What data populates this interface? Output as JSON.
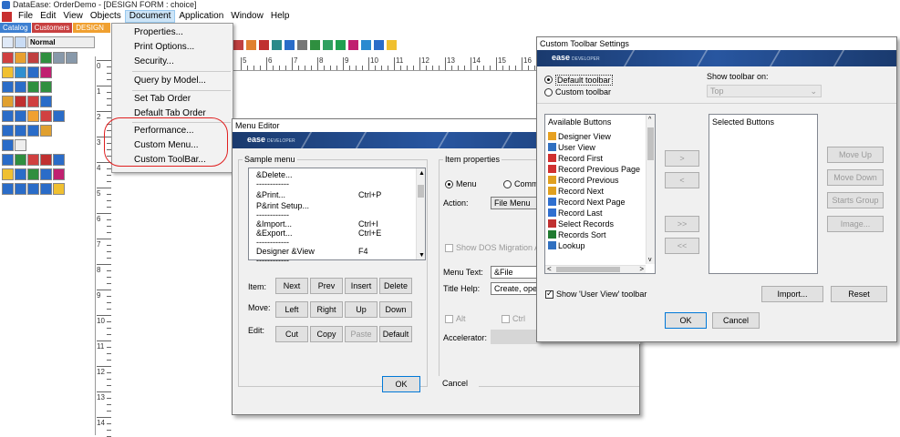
{
  "window": {
    "title": "DataEase: OrderDemo - [DESIGN FORM : choice]"
  },
  "menubar": {
    "items": [
      "File",
      "Edit",
      "View",
      "Objects",
      "Document",
      "Application",
      "Window",
      "Help"
    ],
    "active": "Document"
  },
  "tabstrip": {
    "tabs": [
      "Catalog",
      "Customers",
      "DESIGN FOR"
    ]
  },
  "toolbar": {
    "field_style": "Normal"
  },
  "vruler": {
    "labels": [
      "0",
      "1",
      "2",
      "3",
      "4",
      "5",
      "6",
      "7",
      "8",
      "9",
      "10",
      "11",
      "12",
      "13",
      "14"
    ]
  },
  "hruler": {
    "labels": [
      "5",
      "6",
      "7",
      "8",
      "9",
      "10",
      "11",
      "12",
      "13",
      "14",
      "15",
      "16"
    ]
  },
  "document_menu": {
    "items": [
      {
        "label": "Properties..."
      },
      {
        "label": "Print Options..."
      },
      {
        "label": "Security..."
      },
      {
        "label": "Query by Model..."
      },
      {
        "label": "Set Tab Order"
      },
      {
        "label": "Default Tab Order"
      },
      {
        "label": "Performance..."
      },
      {
        "label": "Custom Menu..."
      },
      {
        "label": "Custom ToolBar..."
      }
    ]
  },
  "menu_editor": {
    "title": "Menu Editor",
    "banner_logo": "ease",
    "banner_sub": "DEVELOPER",
    "sample_menu_label": "Sample menu",
    "sample_rows": [
      {
        "name": "&Delete...",
        "key": ""
      },
      {
        "name": "------------",
        "key": ""
      },
      {
        "name": "&Print...",
        "key": "Ctrl+P"
      },
      {
        "name": "P&rint Setup...",
        "key": ""
      },
      {
        "name": "------------",
        "key": ""
      },
      {
        "name": "&Import...",
        "key": "Ctrl+I"
      },
      {
        "name": "&Export...",
        "key": "Ctrl+E"
      },
      {
        "name": "------------",
        "key": ""
      },
      {
        "name": "Designer &View",
        "key": "F4"
      },
      {
        "name": "------------",
        "key": ""
      }
    ],
    "item_label": "Item:",
    "move_label": "Move:",
    "edit_label": "Edit:",
    "item_buttons": [
      "Next",
      "Prev",
      "Insert",
      "Delete"
    ],
    "move_buttons": [
      "Left",
      "Right",
      "Up",
      "Down"
    ],
    "edit_buttons": [
      "Cut",
      "Copy",
      "Paste",
      "Default"
    ],
    "props_label": "Item properties",
    "radio_menu": "Menu",
    "radio_command": "Comma",
    "action_label": "Action:",
    "action_value": "File Menu",
    "show_dos": "Show DOS Migration Ac",
    "menu_text_label": "Menu Text:",
    "menu_text_value": "&File",
    "title_help_label": "Title Help:",
    "title_help_value": "Create, ope",
    "alt_label": "Alt",
    "ctrl_label": "Ctrl",
    "accel_label": "Accelerator:",
    "ok": "OK",
    "cancel": "Cancel"
  },
  "toolbar_settings": {
    "title": "Custom Toolbar Settings",
    "banner_logo": "ease",
    "banner_sub": "DEVELOPER",
    "radio_default": "Default toolbar",
    "radio_custom": "Custom toolbar",
    "show_on_label": "Show toolbar on:",
    "show_on_value": "Top",
    "available_header": "Available Buttons",
    "selected_header": "Selected Buttons",
    "available": [
      {
        "label": "Designer View",
        "color": "#e6a020"
      },
      {
        "label": "User View",
        "color": "#3070c0"
      },
      {
        "label": "Record First",
        "color": "#d03030"
      },
      {
        "label": "Record Previous Page",
        "color": "#d03030"
      },
      {
        "label": "Record Previous",
        "color": "#e0a020"
      },
      {
        "label": "Record Next",
        "color": "#e0a020"
      },
      {
        "label": "Record Next Page",
        "color": "#2f6fd0"
      },
      {
        "label": "Record Last",
        "color": "#2f6fd0"
      },
      {
        "label": "Select Records",
        "color": "#c03030"
      },
      {
        "label": "Records Sort",
        "color": "#207a30"
      },
      {
        "label": "Lookup",
        "color": "#3070c0"
      }
    ],
    "add": ">",
    "remove": "<",
    "add_all": ">>",
    "remove_all": "<<",
    "move_up": "Move Up",
    "move_down": "Move Down",
    "starts_group": "Starts Group",
    "image": "Image...",
    "show_user_view": "Show 'User View' toolbar",
    "import": "Import...",
    "reset": "Reset",
    "ok": "OK",
    "cancel": "Cancel"
  }
}
